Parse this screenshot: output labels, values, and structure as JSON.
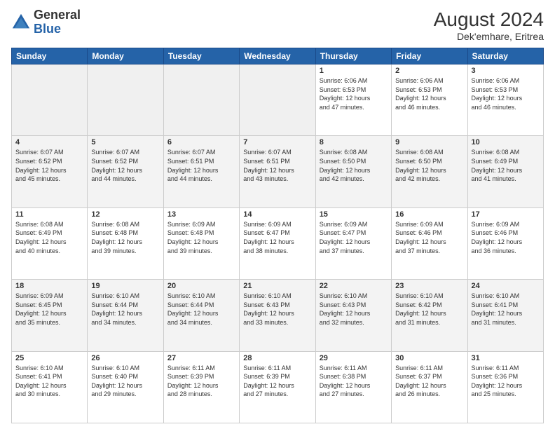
{
  "header": {
    "logo_general": "General",
    "logo_blue": "Blue",
    "month_year": "August 2024",
    "location": "Dek'emhare, Eritrea"
  },
  "days_of_week": [
    "Sunday",
    "Monday",
    "Tuesday",
    "Wednesday",
    "Thursday",
    "Friday",
    "Saturday"
  ],
  "weeks": [
    [
      {
        "day": "",
        "info": ""
      },
      {
        "day": "",
        "info": ""
      },
      {
        "day": "",
        "info": ""
      },
      {
        "day": "",
        "info": ""
      },
      {
        "day": "1",
        "info": "Sunrise: 6:06 AM\nSunset: 6:53 PM\nDaylight: 12 hours\nand 47 minutes."
      },
      {
        "day": "2",
        "info": "Sunrise: 6:06 AM\nSunset: 6:53 PM\nDaylight: 12 hours\nand 46 minutes."
      },
      {
        "day": "3",
        "info": "Sunrise: 6:06 AM\nSunset: 6:53 PM\nDaylight: 12 hours\nand 46 minutes."
      }
    ],
    [
      {
        "day": "4",
        "info": "Sunrise: 6:07 AM\nSunset: 6:52 PM\nDaylight: 12 hours\nand 45 minutes."
      },
      {
        "day": "5",
        "info": "Sunrise: 6:07 AM\nSunset: 6:52 PM\nDaylight: 12 hours\nand 44 minutes."
      },
      {
        "day": "6",
        "info": "Sunrise: 6:07 AM\nSunset: 6:51 PM\nDaylight: 12 hours\nand 44 minutes."
      },
      {
        "day": "7",
        "info": "Sunrise: 6:07 AM\nSunset: 6:51 PM\nDaylight: 12 hours\nand 43 minutes."
      },
      {
        "day": "8",
        "info": "Sunrise: 6:08 AM\nSunset: 6:50 PM\nDaylight: 12 hours\nand 42 minutes."
      },
      {
        "day": "9",
        "info": "Sunrise: 6:08 AM\nSunset: 6:50 PM\nDaylight: 12 hours\nand 42 minutes."
      },
      {
        "day": "10",
        "info": "Sunrise: 6:08 AM\nSunset: 6:49 PM\nDaylight: 12 hours\nand 41 minutes."
      }
    ],
    [
      {
        "day": "11",
        "info": "Sunrise: 6:08 AM\nSunset: 6:49 PM\nDaylight: 12 hours\nand 40 minutes."
      },
      {
        "day": "12",
        "info": "Sunrise: 6:08 AM\nSunset: 6:48 PM\nDaylight: 12 hours\nand 39 minutes."
      },
      {
        "day": "13",
        "info": "Sunrise: 6:09 AM\nSunset: 6:48 PM\nDaylight: 12 hours\nand 39 minutes."
      },
      {
        "day": "14",
        "info": "Sunrise: 6:09 AM\nSunset: 6:47 PM\nDaylight: 12 hours\nand 38 minutes."
      },
      {
        "day": "15",
        "info": "Sunrise: 6:09 AM\nSunset: 6:47 PM\nDaylight: 12 hours\nand 37 minutes."
      },
      {
        "day": "16",
        "info": "Sunrise: 6:09 AM\nSunset: 6:46 PM\nDaylight: 12 hours\nand 37 minutes."
      },
      {
        "day": "17",
        "info": "Sunrise: 6:09 AM\nSunset: 6:46 PM\nDaylight: 12 hours\nand 36 minutes."
      }
    ],
    [
      {
        "day": "18",
        "info": "Sunrise: 6:09 AM\nSunset: 6:45 PM\nDaylight: 12 hours\nand 35 minutes."
      },
      {
        "day": "19",
        "info": "Sunrise: 6:10 AM\nSunset: 6:44 PM\nDaylight: 12 hours\nand 34 minutes."
      },
      {
        "day": "20",
        "info": "Sunrise: 6:10 AM\nSunset: 6:44 PM\nDaylight: 12 hours\nand 34 minutes."
      },
      {
        "day": "21",
        "info": "Sunrise: 6:10 AM\nSunset: 6:43 PM\nDaylight: 12 hours\nand 33 minutes."
      },
      {
        "day": "22",
        "info": "Sunrise: 6:10 AM\nSunset: 6:43 PM\nDaylight: 12 hours\nand 32 minutes."
      },
      {
        "day": "23",
        "info": "Sunrise: 6:10 AM\nSunset: 6:42 PM\nDaylight: 12 hours\nand 31 minutes."
      },
      {
        "day": "24",
        "info": "Sunrise: 6:10 AM\nSunset: 6:41 PM\nDaylight: 12 hours\nand 31 minutes."
      }
    ],
    [
      {
        "day": "25",
        "info": "Sunrise: 6:10 AM\nSunset: 6:41 PM\nDaylight: 12 hours\nand 30 minutes."
      },
      {
        "day": "26",
        "info": "Sunrise: 6:10 AM\nSunset: 6:40 PM\nDaylight: 12 hours\nand 29 minutes."
      },
      {
        "day": "27",
        "info": "Sunrise: 6:11 AM\nSunset: 6:39 PM\nDaylight: 12 hours\nand 28 minutes."
      },
      {
        "day": "28",
        "info": "Sunrise: 6:11 AM\nSunset: 6:39 PM\nDaylight: 12 hours\nand 27 minutes."
      },
      {
        "day": "29",
        "info": "Sunrise: 6:11 AM\nSunset: 6:38 PM\nDaylight: 12 hours\nand 27 minutes."
      },
      {
        "day": "30",
        "info": "Sunrise: 6:11 AM\nSunset: 6:37 PM\nDaylight: 12 hours\nand 26 minutes."
      },
      {
        "day": "31",
        "info": "Sunrise: 6:11 AM\nSunset: 6:36 PM\nDaylight: 12 hours\nand 25 minutes."
      }
    ]
  ]
}
